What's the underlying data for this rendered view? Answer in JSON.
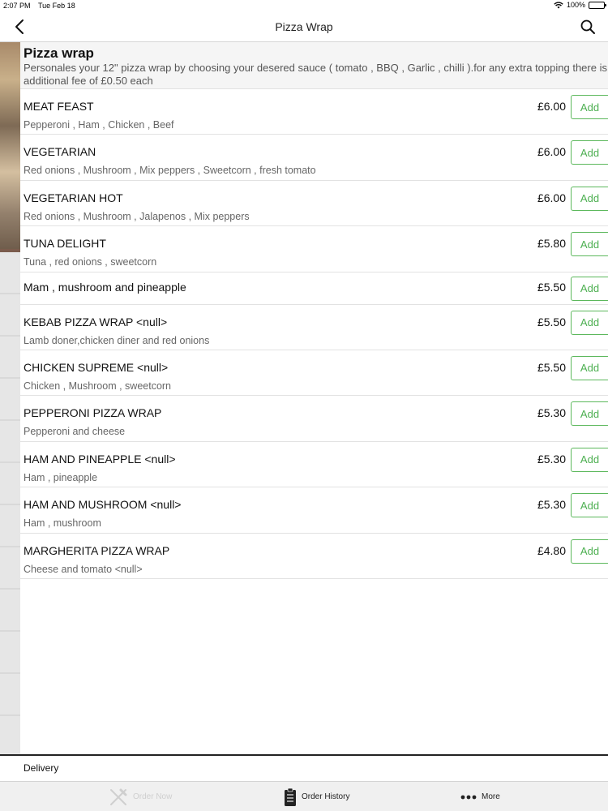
{
  "status_bar": {
    "time": "2:07 PM",
    "date": "Tue Feb 18",
    "battery": "100%"
  },
  "nav": {
    "title": "Pizza Wrap"
  },
  "category": {
    "title": "Pizza wrap",
    "description": "Personales your 12\" pizza wrap by choosing your desered sauce ( tomato , BBQ , Garlic , chilli ).for any extra topping there is an additional fee of £0.50 each"
  },
  "items": [
    {
      "name": "MEAT FEAST",
      "desc": "Pepperoni , Ham , Chicken , Beef",
      "price": "£6.00",
      "add": "Add"
    },
    {
      "name": "VEGETARIAN",
      "desc": "Red onions , Mushroom , Mix peppers , Sweetcorn , fresh tomato",
      "price": "£6.00",
      "add": "Add"
    },
    {
      "name": "VEGETARIAN  HOT",
      "desc": "Red onions , Mushroom , Jalapenos , Mix peppers",
      "price": "£6.00",
      "add": "Add"
    },
    {
      "name": "TUNA DELIGHT",
      "desc": "Tuna , red onions , sweetcorn",
      "price": "£5.80",
      "add": "Add"
    },
    {
      "name": "Mam , mushroom and pineapple",
      "desc": "",
      "price": "£5.50",
      "add": "Add"
    },
    {
      "name": "KEBAB PIZZA WRAP <null>",
      "desc": "Lamb doner,chicken diner and red onions",
      "price": "£5.50",
      "add": "Add"
    },
    {
      "name": "CHICKEN SUPREME <null>",
      "desc": "Chicken , Mushroom , sweetcorn",
      "price": "£5.50",
      "add": "Add"
    },
    {
      "name": "PEPPERONI PIZZA WRAP",
      "desc": "Pepperoni and cheese",
      "price": "£5.30",
      "add": "Add"
    },
    {
      "name": "HAM AND PINEAPPLE <null>",
      "desc": "Ham , pineapple",
      "price": "£5.30",
      "add": "Add"
    },
    {
      "name": "HAM AND MUSHROOM <null>",
      "desc": "Ham , mushroom",
      "price": "£5.30",
      "add": "Add"
    },
    {
      "name": "MARGHERITA PIZZA WRAP",
      "desc": "Cheese and tomato <null>",
      "price": "£4.80",
      "add": "Add"
    }
  ],
  "delivery": {
    "label": "Delivery"
  },
  "tabs": {
    "order_now": "Order Now",
    "order_history": "Order History",
    "more": "More"
  },
  "colors": {
    "accent": "#4caf50",
    "add_border": "#5cb85c",
    "disabled_tab": "#cfcfcf"
  },
  "icons": {
    "back": "chevron-left-icon",
    "search": "search-icon",
    "order_now": "fork-knife-icon",
    "order_history": "clipboard-icon",
    "more": "more-dots-icon"
  }
}
